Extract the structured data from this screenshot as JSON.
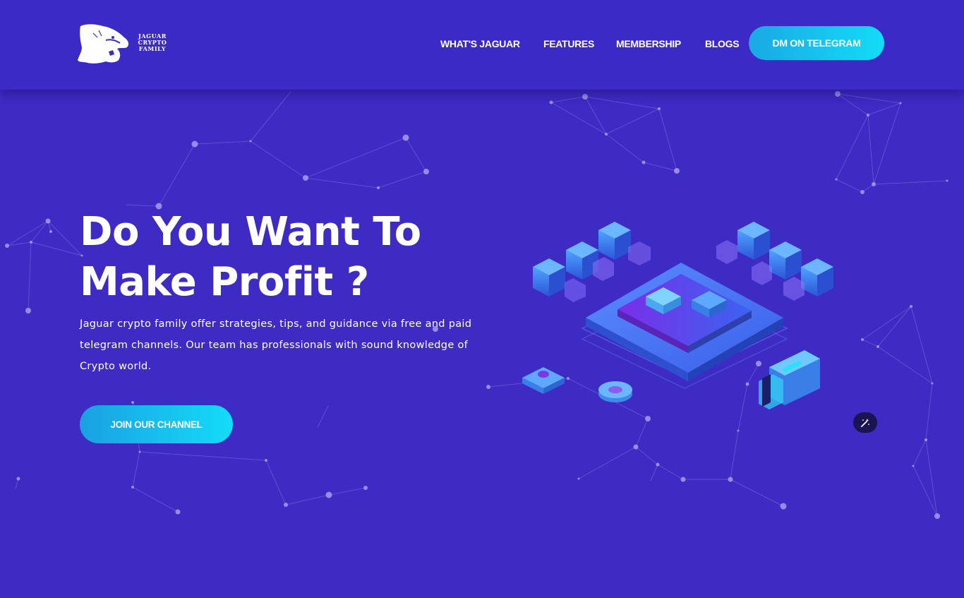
{
  "brand": {
    "logo_lines": [
      "JAGUAR",
      "CRYPTO",
      "FAMILY"
    ],
    "icon": "jaguar-head-icon"
  },
  "nav": {
    "items": [
      {
        "label": "WHAT'S JAGUAR"
      },
      {
        "label": "FEATURES"
      },
      {
        "label": "MEMBERSHIP"
      },
      {
        "label": "BLOGS"
      }
    ],
    "cta_label": "DM ON TELEGRAM"
  },
  "hero": {
    "title_line1": "Do You Want To",
    "title_line2": "Make Profit ?",
    "description": "Jaguar crypto family offer strategies, tips, and guidance via free and paid telegram channels. Our team has professionals with sound knowledge of Crypto world.",
    "cta_label": "JOIN OUR CHANNEL",
    "illustration": "isometric-blockchain-illustration"
  },
  "floating_button": {
    "icon": "magic-wand-icon"
  },
  "colors": {
    "background": "#3d2bc4",
    "button_gradient_start": "#1aa8e4",
    "button_gradient_end": "#13dcf7",
    "text": "#ffffff"
  }
}
